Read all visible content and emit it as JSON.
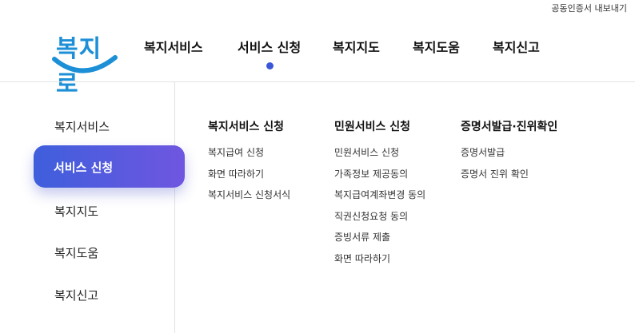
{
  "utility": {
    "certificate_export": "공동인증서 내보내기"
  },
  "logo": {
    "text": "복지로"
  },
  "colors": {
    "brand_blue": "#1c8fd6",
    "accent": "#3b57d9",
    "active_gradient_start": "#3e5fdc",
    "active_gradient_end": "#6f56e0"
  },
  "gnb": {
    "items": [
      {
        "label": "복지서비스"
      },
      {
        "label": "서비스 신청"
      },
      {
        "label": "복지지도"
      },
      {
        "label": "복지도움"
      },
      {
        "label": "복지신고"
      }
    ],
    "active_index": 1
  },
  "sidebar": {
    "items": [
      {
        "label": "복지서비스"
      },
      {
        "label": "서비스 신청"
      },
      {
        "label": "복지지도"
      },
      {
        "label": "복지도움"
      },
      {
        "label": "복지신고"
      }
    ],
    "active_index": 1
  },
  "submenu": {
    "columns": [
      {
        "title": "복지서비스 신청",
        "links": [
          "복지급여 신청",
          "화면 따라하기",
          "복지서비스 신청서식"
        ]
      },
      {
        "title": "민원서비스 신청",
        "links": [
          "민원서비스 신청",
          "가족정보 제공동의",
          "복지급여계좌변경 동의",
          "직권신청요청 동의",
          "증빙서류 제출",
          "화면 따라하기"
        ]
      },
      {
        "title": "증명서발급·진위확인",
        "links": [
          "증명서발급",
          "증명서 진위 확인"
        ]
      }
    ]
  }
}
